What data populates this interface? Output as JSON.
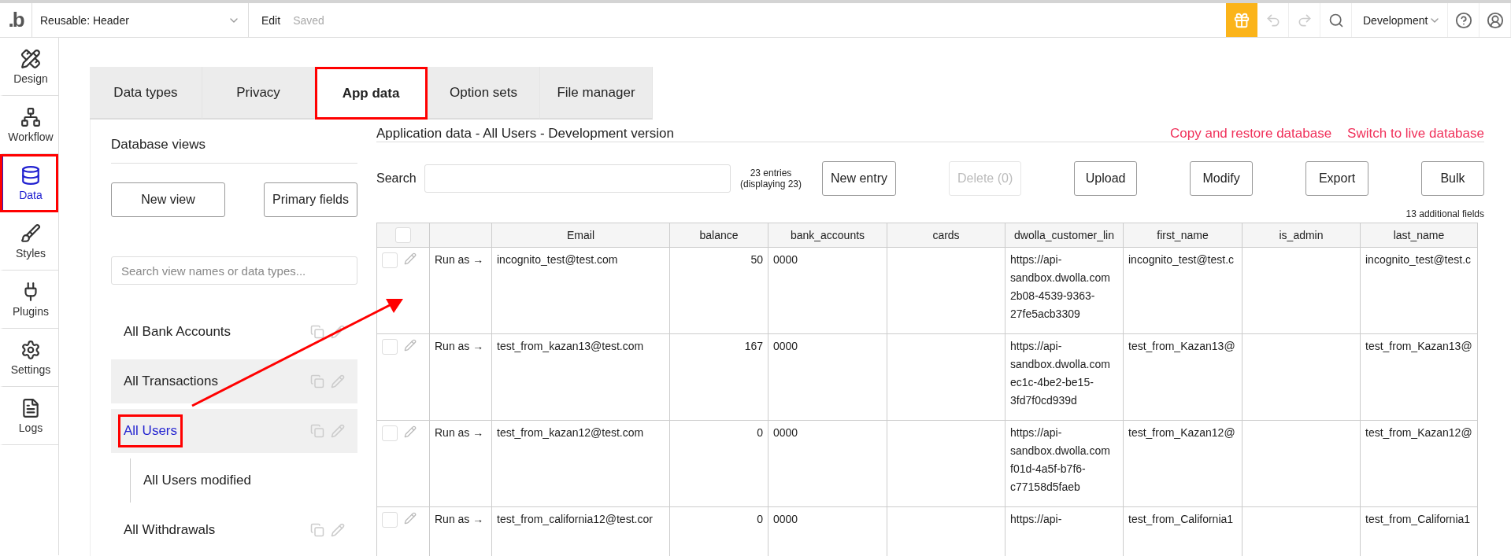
{
  "topbar": {
    "logo": ".b",
    "page_select": "Reusable: Header",
    "edit": "Edit",
    "save_status": "Saved",
    "environment": "Development",
    "undo_disabled": true,
    "redo_disabled": true
  },
  "sidebar": {
    "items": [
      {
        "kind": "design",
        "label": "Design",
        "selected": false,
        "highlighted": false
      },
      {
        "kind": "workflow",
        "label": "Workflow",
        "selected": false,
        "highlighted": false
      },
      {
        "kind": "data",
        "label": "Data",
        "selected": true,
        "highlighted": true
      },
      {
        "kind": "styles",
        "label": "Styles",
        "selected": false,
        "highlighted": false
      },
      {
        "kind": "plugins",
        "label": "Plugins",
        "selected": false,
        "highlighted": false
      },
      {
        "kind": "settings",
        "label": "Settings",
        "selected": false,
        "highlighted": false
      },
      {
        "kind": "logs",
        "label": "Logs",
        "selected": false,
        "highlighted": false
      }
    ]
  },
  "tabs": [
    {
      "label": "Data types",
      "selected": false,
      "highlighted": false
    },
    {
      "label": "Privacy",
      "selected": false,
      "highlighted": false
    },
    {
      "label": "App data",
      "selected": true,
      "highlighted": true
    },
    {
      "label": "Option sets",
      "selected": false,
      "highlighted": false
    },
    {
      "label": "File manager",
      "selected": false,
      "highlighted": false
    }
  ],
  "database_views": {
    "title": "Database views",
    "buttons": [
      "New view",
      "Primary fields"
    ],
    "search": {
      "placeholder": "Search view names or data types..."
    },
    "views": [
      {
        "label": "All Bank Accounts",
        "selected": false,
        "shaded": false,
        "highlighted": false
      },
      {
        "label": "All Transactions",
        "selected": false,
        "shaded": true,
        "highlighted": false
      },
      {
        "label": "All Users",
        "selected": true,
        "shaded": true,
        "highlighted": true,
        "children": [
          {
            "label": "All Users modified",
            "selected": false,
            "shaded": false,
            "highlighted": false
          }
        ]
      },
      {
        "label": "All Withdrawals",
        "selected": false,
        "shaded": false,
        "highlighted": false
      }
    ]
  },
  "app_data": {
    "title": "Application data - All Users - Development version",
    "links": [
      "Copy and restore database",
      "Switch to live database"
    ],
    "search_label": "Search",
    "entries": "23 entries\n(displaying 23)",
    "buttons": [
      {
        "label": "New entry",
        "disabled": false
      },
      {
        "label": "Delete (0)",
        "disabled": true
      },
      {
        "label": "Upload",
        "disabled": false
      },
      {
        "label": "Modify",
        "disabled": false
      },
      {
        "label": "Export",
        "disabled": false
      },
      {
        "label": "Bulk",
        "disabled": false
      }
    ],
    "additional_fields": "13 additional fields",
    "table": {
      "select_all_checked": false,
      "columns": [
        "Email",
        "balance",
        "bank_accounts",
        "cards",
        "dwolla_customer_lin",
        "first_name",
        "is_admin",
        "last_name"
      ],
      "rows": [
        {
          "checked": false,
          "run_as": "Run as →",
          "cells": [
            "incognito_test@test.com",
            "50",
            "0000",
            "",
            "https://api-\nsandbox.dwolla.com\n2b08-4539-9363-\n27fe5acb3309",
            "incognito_test@test.c",
            "",
            "incognito_test@test.c"
          ]
        },
        {
          "checked": false,
          "run_as": "Run as →",
          "cells": [
            "test_from_kazan13@test.com",
            "167",
            "0000",
            "",
            "https://api-\nsandbox.dwolla.com\nec1c-4be2-be15-\n3fd7f0cd939d",
            "test_from_Kazan13@",
            "",
            "test_from_Kazan13@"
          ]
        },
        {
          "checked": false,
          "run_as": "Run as →",
          "cells": [
            "test_from_kazan12@test.com",
            "0",
            "0000",
            "",
            "https://api-\nsandbox.dwolla.com\nf01d-4a5f-b7f6-\nc77158d5faeb",
            "test_from_Kazan12@",
            "",
            "test_from_Kazan12@"
          ]
        },
        {
          "checked": false,
          "run_as": "Run as →",
          "cells": [
            "test_from_california12@test.cor",
            "0",
            "0000",
            "",
            "https://api-",
            "test_from_California1",
            "",
            "test_from_California1"
          ]
        }
      ]
    }
  }
}
